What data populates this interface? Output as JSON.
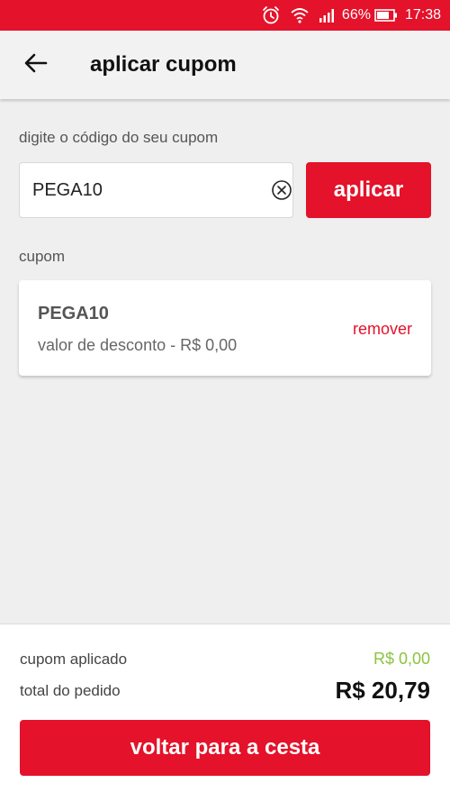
{
  "status_bar": {
    "battery_percent": "66%",
    "time": "17:38",
    "icons": [
      "alarm-icon",
      "wifi-icon",
      "signal-icon",
      "battery-icon"
    ]
  },
  "header": {
    "title": "aplicar cupom",
    "back_icon": "arrow-left-icon"
  },
  "coupon_form": {
    "prompt": "digite o código do seu cupom",
    "input_value": "PEGA10",
    "apply_label": "aplicar"
  },
  "coupon_list": {
    "section_label": "cupom",
    "items": [
      {
        "code": "PEGA10",
        "discount_text": "valor de desconto - R$ 0,00",
        "remove_label": "remover"
      }
    ]
  },
  "summary": {
    "coupon_label": "cupom aplicado",
    "coupon_value": "R$ 0,00",
    "total_label": "total do pedido",
    "total_value": "R$ 20,79",
    "back_button_label": "voltar para a cesta"
  },
  "colors": {
    "brand_red": "#e4122a",
    "success_green": "#8bc43f",
    "background": "#efefef"
  }
}
